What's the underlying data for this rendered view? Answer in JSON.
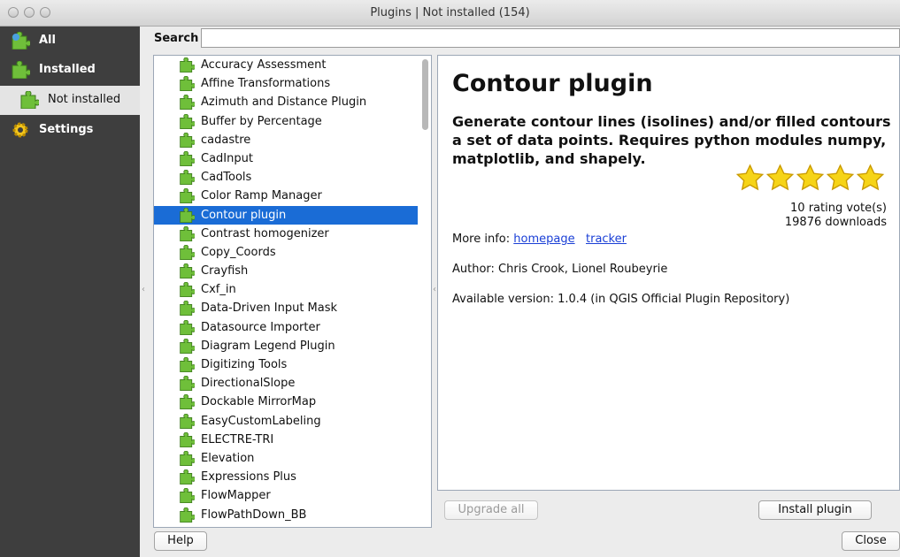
{
  "window": {
    "title": "Plugins | Not installed (154)"
  },
  "sidebar": {
    "items": [
      {
        "label": "All",
        "icon": "puzzle-all-icon",
        "active": false
      },
      {
        "label": "Installed",
        "icon": "puzzle-installed-icon",
        "active": false
      },
      {
        "label": "Not installed",
        "icon": "puzzle-not-installed-icon",
        "active": true
      },
      {
        "label": "Settings",
        "icon": "gear-icon",
        "active": false
      }
    ]
  },
  "search": {
    "label": "Search",
    "value": "",
    "placeholder": ""
  },
  "plugin_list": {
    "items": [
      "Accuracy Assessment",
      "Affine Transformations",
      "Azimuth and Distance Plugin",
      "Buffer by Percentage",
      "cadastre",
      "CadInput",
      "CadTools",
      "Color Ramp Manager",
      "Contour plugin",
      "Contrast homogenizer",
      "Copy_Coords",
      "Crayfish",
      "Cxf_in",
      "Data-Driven Input Mask",
      "Datasource Importer",
      "Diagram Legend Plugin",
      "Digitizing Tools",
      "DirectionalSlope",
      "Dockable MirrorMap",
      "EasyCustomLabeling",
      "ELECTRE-TRI",
      "Elevation",
      "Expressions Plus",
      "FlowMapper",
      "FlowPathDown_BB"
    ],
    "selected": "Contour plugin"
  },
  "details": {
    "title": "Contour plugin",
    "description": "Generate contour lines (isolines) and/or filled contours a set of data points. Requires python modules numpy, matplotlib, and shapely.",
    "rating_stars": 5,
    "votes": "10 rating vote(s)",
    "downloads": "19876 downloads",
    "more_info_label": "More info:",
    "homepage_link": "homepage",
    "tracker_link": "tracker",
    "author": "Author: Chris Crook, Lionel Roubeyrie",
    "version": "Available version: 1.0.4 (in QGIS Official Plugin Repository)"
  },
  "buttons": {
    "upgrade_all": "Upgrade all",
    "install": "Install plugin",
    "help": "Help",
    "close": "Close"
  },
  "colors": {
    "sidebar_bg": "#3e3e3e",
    "selection": "#1a6cd6",
    "star": "#f6d417"
  }
}
